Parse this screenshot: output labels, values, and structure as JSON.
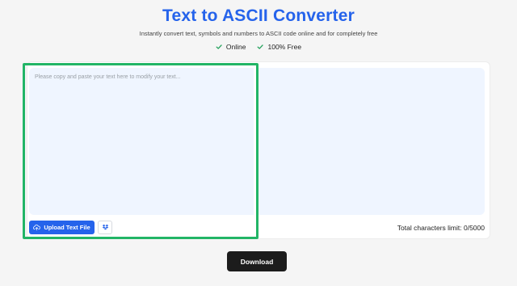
{
  "header": {
    "title": "Text to ASCII Converter",
    "subtitle": "Instantly convert text, symbols and numbers to ASCII code online and for completely free"
  },
  "features": [
    {
      "label": "Online",
      "icon": "check-icon"
    },
    {
      "label": "100% Free",
      "icon": "check-icon"
    }
  ],
  "editor": {
    "placeholder": "Please copy and paste your text here to modify your text...",
    "upload_label": "Upload Text File",
    "upload_icon": "cloud-upload-icon",
    "dropbox_icon": "dropbox-icon",
    "char_limit": "Total characters limit: 0/5000"
  },
  "actions": {
    "download_label": "Download"
  },
  "colors": {
    "accent": "#2563eb",
    "check": "#22a05a",
    "highlight": "#22b566",
    "panel": "#eff5ff",
    "download": "#1c1c1c"
  }
}
